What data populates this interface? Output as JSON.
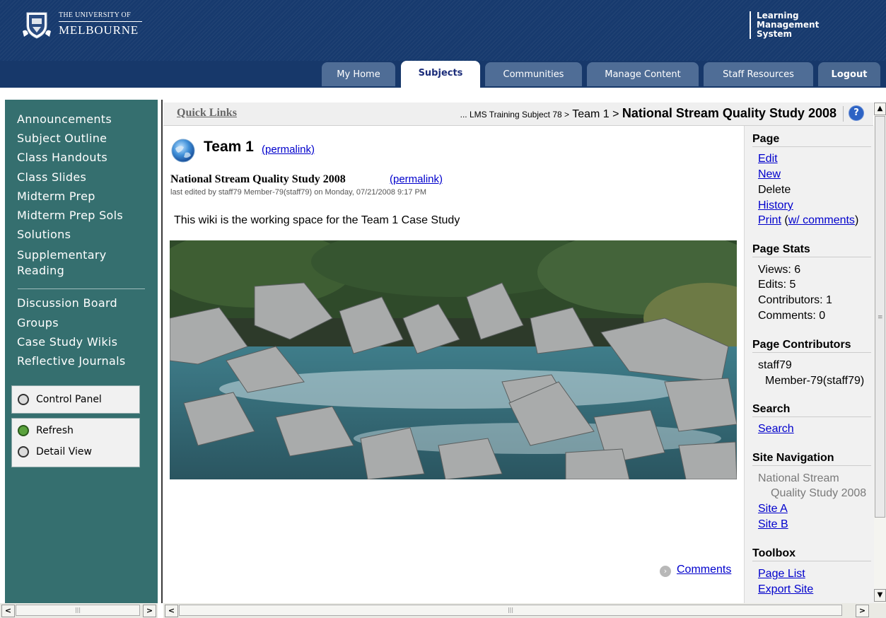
{
  "header": {
    "university_top": "THE UNIVERSITY OF",
    "university_name": "MELBOURNE",
    "lms_lines": [
      "Learning",
      "Management",
      "System"
    ],
    "tabs": [
      {
        "label": "My Home",
        "active": false
      },
      {
        "label": "Subjects",
        "active": true
      },
      {
        "label": "Communities",
        "active": false
      },
      {
        "label": "Manage Content",
        "active": false
      },
      {
        "label": "Staff Resources",
        "active": false
      },
      {
        "label": "Logout",
        "active": false
      }
    ]
  },
  "sidebar": {
    "items": [
      "Announcements",
      "Subject Outline",
      "Class Handouts",
      "Class Slides",
      "Midterm Prep",
      "Midterm Prep Sols",
      "Solutions",
      "Supplementary Reading"
    ],
    "items2": [
      "Discussion Board",
      "Groups",
      "Case Study Wikis",
      "Reflective Journals"
    ],
    "control_panel": "Control Panel",
    "refresh": "Refresh",
    "detail_view": "Detail View"
  },
  "quickbar": {
    "quick_links": "Quick Links",
    "crumb_prefix": "... LMS Training Subject 78 >",
    "crumb_mid": " Team 1 > ",
    "crumb_current": "National Stream Quality Study 2008",
    "help_icon": "?"
  },
  "wiki": {
    "team_title": "Team 1",
    "team_permalink": "(permalink)",
    "page_title": "National Stream Quality Study 2008",
    "page_permalink": "(permalink)",
    "edited": "last edited by staff79 Member-79(staff79) on Monday, 07/21/2008 9:17 PM",
    "intro": "This wiki is the working space for the Team 1 Case Study",
    "comments": "Comments"
  },
  "right_panel": {
    "page_head": "Page",
    "edit": "Edit",
    "new": "New",
    "delete": "Delete",
    "history": "History",
    "print": "Print",
    "print_comments": "w/ comments",
    "stats_head": "Page Stats",
    "views": "Views: 6",
    "edits": "Edits: 5",
    "contributors": "Contributors: 1",
    "comments": "Comments: 0",
    "contributors_head": "Page Contributors",
    "contributor_user": "staff79",
    "contributor_name": "Member-79(staff79)",
    "search_head": "Search",
    "search_link": "Search",
    "nav_head": "Site Navigation",
    "nav_current_1": "National Stream",
    "nav_current_2": "Quality Study 2008",
    "site_a": "Site A",
    "site_b": "Site B",
    "toolbox_head": "Toolbox",
    "page_list": "Page List",
    "export_site": "Export Site"
  },
  "colors": {
    "header_blue": "#173a6e",
    "sidebar_teal": "#356f6f",
    "link_blue": "#0000cc",
    "active_tab_text": "#1c2d7a"
  }
}
